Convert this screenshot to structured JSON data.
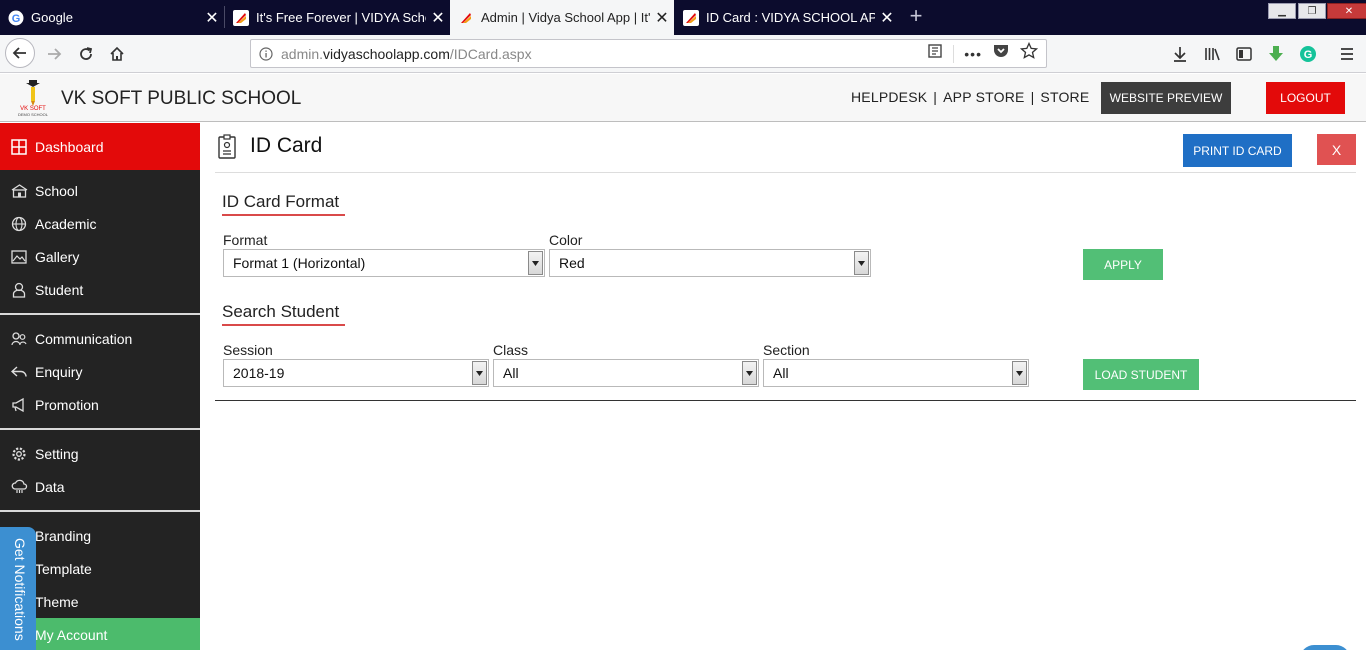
{
  "browser": {
    "tabs": [
      {
        "title": "Google",
        "icon": "google-icon",
        "active": false
      },
      {
        "title": "It's Free Forever | VIDYA School",
        "icon": "vidya-icon",
        "active": false
      },
      {
        "title": "Admin | Vidya School App | It's",
        "icon": "vidya-icon",
        "active": true
      },
      {
        "title": "ID Card : VIDYA SCHOOL APP",
        "icon": "vidya-icon",
        "active": false
      }
    ],
    "url_prefix": "admin.",
    "url_domain": "vidyaschoolapp.com",
    "url_path": "/IDCard.aspx",
    "page_actions_label": "•••"
  },
  "header": {
    "school_name": "VK SOFT PUBLIC SCHOOL",
    "logo_text_line1": "VK SOFT",
    "logo_text_line2": "DEMO SCHOOL",
    "links": {
      "helpdesk": "HELPDESK",
      "app_store": "APP STORE",
      "store": "STORE",
      "separator": "|"
    },
    "website_preview": "WEBSITE PREVIEW",
    "logout": "LOGOUT"
  },
  "sidebar": {
    "dashboard": "Dashboard",
    "school": "School",
    "academic": "Academic",
    "gallery": "Gallery",
    "student": "Student",
    "communication": "Communication",
    "enquiry": "Enquiry",
    "promotion": "Promotion",
    "setting": "Setting",
    "data": "Data",
    "branding": "Branding",
    "template": "Template",
    "theme": "Theme",
    "my_account": "My Account",
    "notification_tab": "Get Notifications"
  },
  "main": {
    "page_title": "ID Card",
    "print_button": "PRINT ID CARD",
    "close_button": "X",
    "format_section": {
      "heading": "ID Card Format",
      "format_label": "Format",
      "format_value": "Format 1 (Horizontal)",
      "color_label": "Color",
      "color_value": "Red",
      "apply_button": "APPLY"
    },
    "search_section": {
      "heading": "Search Student",
      "session_label": "Session",
      "session_value": "2018-19",
      "class_label": "Class",
      "class_value": "All",
      "section_label": "Section",
      "section_value": "All",
      "load_button": "LOAD STUDENT"
    }
  },
  "colors": {
    "tabstrip_bg": "#0c0c2d",
    "sidebar_bg": "#232323",
    "dashboard_red": "#e30a0a",
    "account_green": "#4cbb6c",
    "print_blue": "#1f6fc5",
    "apply_green": "#52bf76",
    "close_red": "#e05252",
    "section_underline": "#d94a4a"
  }
}
